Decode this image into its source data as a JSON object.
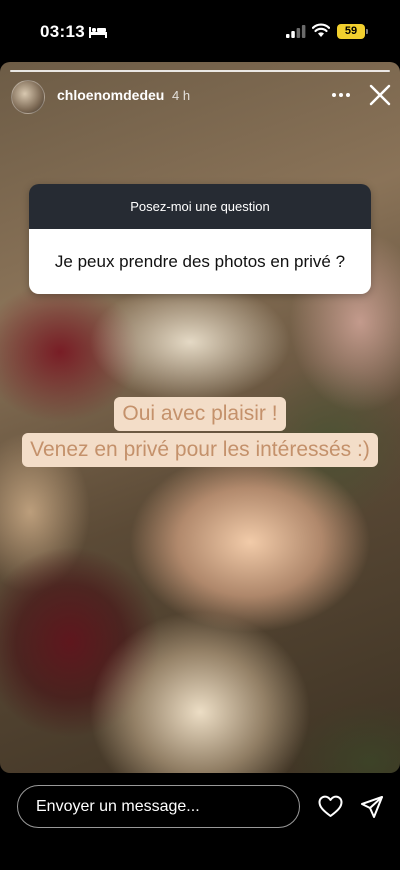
{
  "status_bar": {
    "time": "03:13",
    "battery": "59",
    "sleep_icon": "bed-icon",
    "signal_icon": "signal-icon",
    "wifi_icon": "wifi-icon",
    "battery_color": "#f2d02e"
  },
  "story": {
    "username": "chloenomdedeu",
    "time_ago": "4 h",
    "more_icon": "more-icon",
    "close_icon": "close-icon"
  },
  "question_sticker": {
    "header": "Posez-moi une question",
    "question": "Je peux prendre des photos en privé ?",
    "header_color": "#262b33"
  },
  "answer": {
    "line1": "Oui avec plaisir !",
    "line2": "Venez en privé pour les intéressés :)",
    "text_color": "#c4916b",
    "background_color": "#f3ddc8"
  },
  "bottom_bar": {
    "message_placeholder": "Envoyer un message...",
    "like_icon": "heart-icon",
    "send_icon": "send-icon"
  }
}
